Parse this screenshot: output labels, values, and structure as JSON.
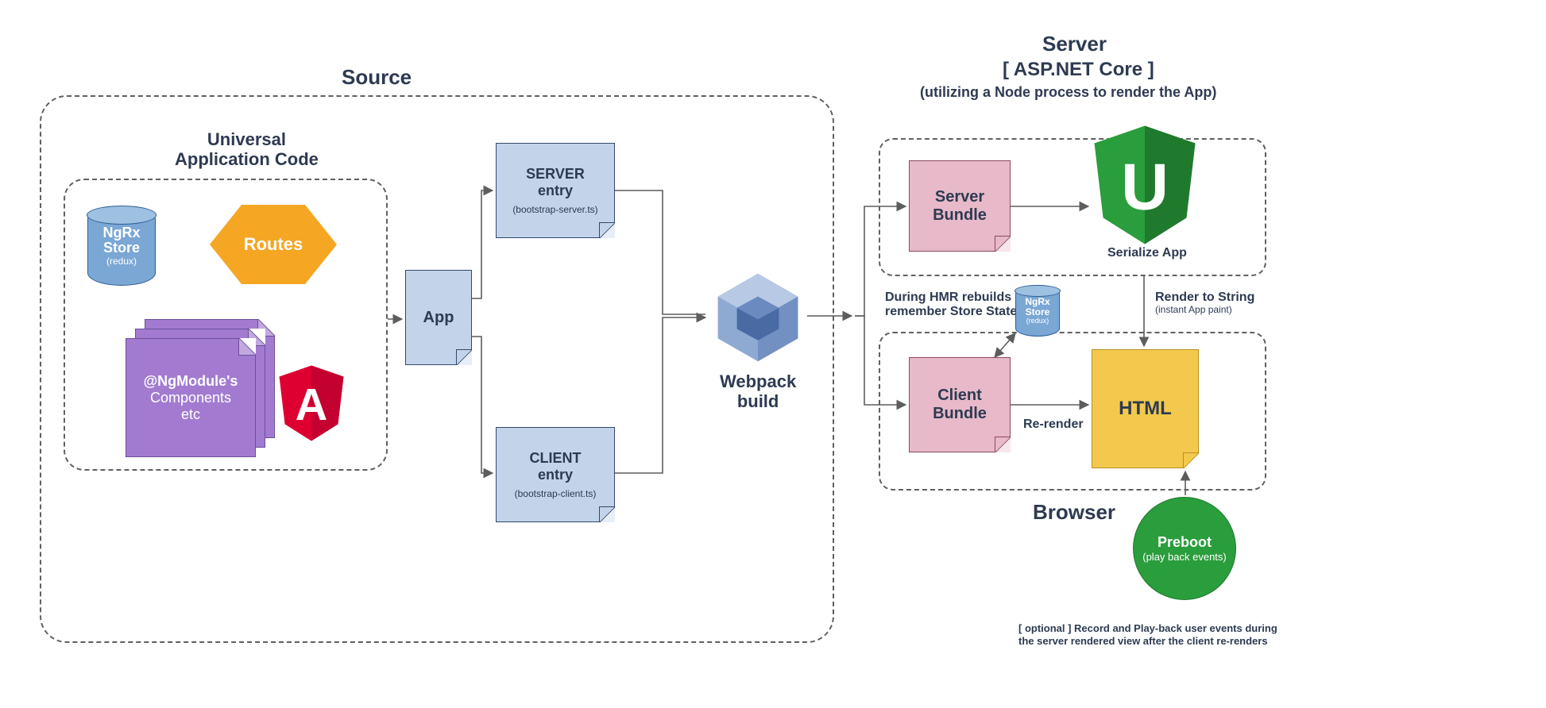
{
  "diagram": {
    "source": {
      "title": "Source",
      "uac_title_l1": "Universal",
      "uac_title_l2": "Application Code",
      "ngrx_l1": "NgRx",
      "ngrx_l2": "Store",
      "ngrx_l3": "(redux)",
      "routes": "Routes",
      "module_l1": "@NgModule's",
      "module_l2": "Components",
      "module_l3": "etc",
      "angular_letter": "A",
      "app": "App",
      "server_entry_l1": "SERVER",
      "server_entry_l2": "entry",
      "server_entry_file": "(bootstrap-server.ts)",
      "client_entry_l1": "CLIENT",
      "client_entry_l2": "entry",
      "client_entry_file": "(bootstrap-client.ts)"
    },
    "webpack": {
      "title_l1": "Webpack",
      "title_l2": "build"
    },
    "server": {
      "title": "Server",
      "subtitle": "[ ASP.NET Core ]",
      "note": "(utilizing a Node process to render the App)",
      "bundle_l1": "Server",
      "bundle_l2": "Bundle",
      "u_letter": "U",
      "serialize": "Serialize App",
      "render_l1": "Render to String",
      "render_l2": "(instant App paint)"
    },
    "browser": {
      "title": "Browser",
      "bundle_l1": "Client",
      "bundle_l2": "Bundle",
      "html": "HTML",
      "rerender": "Re-render",
      "hmr_l1": "During HMR rebuilds",
      "hmr_l2": "remember Store State",
      "ngrx_l1": "NgRx",
      "ngrx_l2": "Store",
      "ngrx_l3": "(redux)",
      "preboot_l1": "Preboot",
      "preboot_l2": "(play back events)",
      "footnote_l1": "[ optional ] Record and Play-back user events during",
      "footnote_l2": "the server rendered view after the client re-renders"
    }
  }
}
